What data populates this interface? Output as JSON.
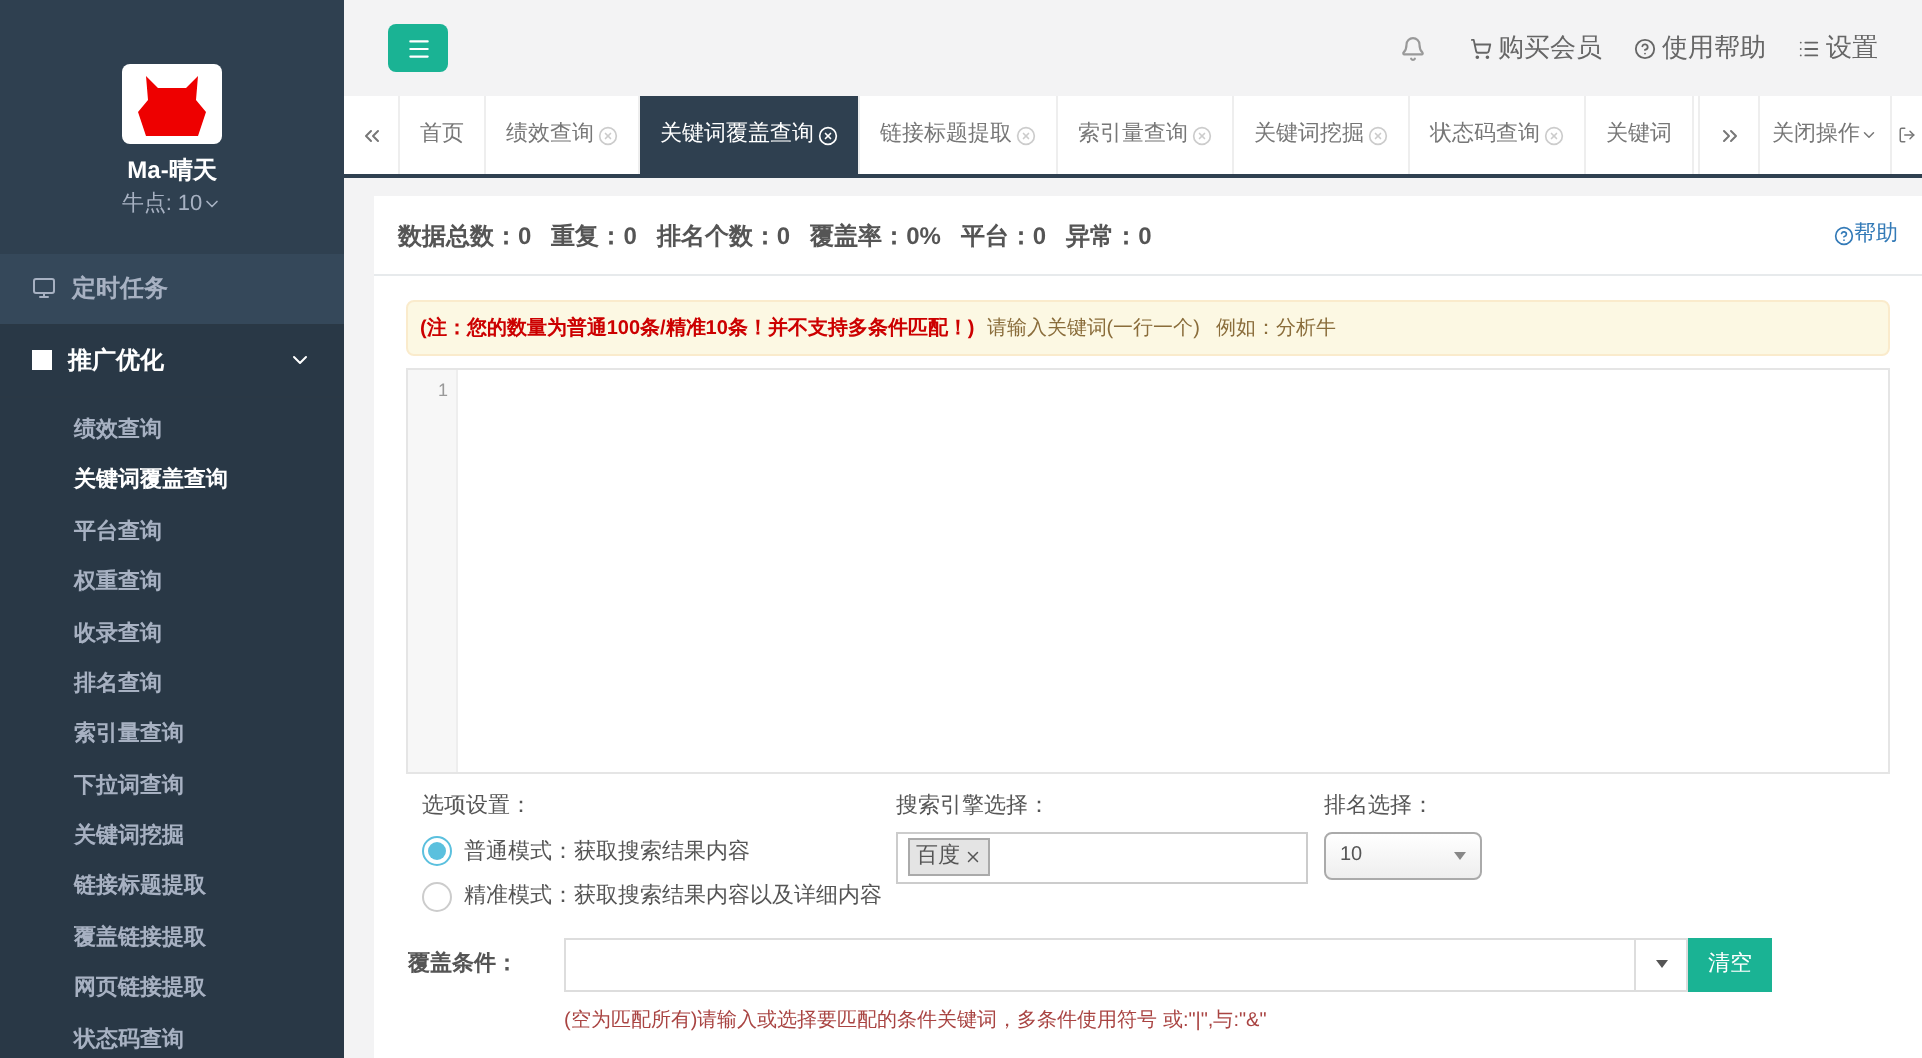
{
  "profile": {
    "name": "Ma-晴天",
    "points": "牛点: 10"
  },
  "sidebar": {
    "items": [
      {
        "label": "定时任务",
        "kind": "single",
        "expanded": false
      },
      {
        "label": "推广优化",
        "kind": "group",
        "expanded": true,
        "children": [
          {
            "label": "绩效查询",
            "selected": false
          },
          {
            "label": "关键词覆盖查询",
            "selected": true
          },
          {
            "label": "平台查询",
            "selected": false
          },
          {
            "label": "权重查询",
            "selected": false
          },
          {
            "label": "收录查询",
            "selected": false
          },
          {
            "label": "排名查询",
            "selected": false
          },
          {
            "label": "索引量查询",
            "selected": false
          },
          {
            "label": "下拉词查询",
            "selected": false
          },
          {
            "label": "关键词挖掘",
            "selected": false
          },
          {
            "label": "链接标题提取",
            "selected": false
          },
          {
            "label": "覆盖链接提取",
            "selected": false
          },
          {
            "label": "网页链接提取",
            "selected": false
          },
          {
            "label": "状态码查询",
            "selected": false
          }
        ]
      }
    ]
  },
  "topbar": {
    "links": [
      "购买会员",
      "使用帮助",
      "设置"
    ]
  },
  "tabs": [
    {
      "label": "首页",
      "closable": false,
      "selected": false
    },
    {
      "label": "绩效查询",
      "closable": true,
      "selected": false
    },
    {
      "label": "关键词覆盖查询",
      "closable": true,
      "selected": true
    },
    {
      "label": "链接标题提取",
      "closable": true,
      "selected": false
    },
    {
      "label": "索引量查询",
      "closable": true,
      "selected": false
    },
    {
      "label": "关键词挖掘",
      "closable": true,
      "selected": false
    },
    {
      "label": "状态码查询",
      "closable": true,
      "selected": false
    },
    {
      "label": "关键词",
      "closable": false,
      "selected": false
    }
  ],
  "tab_actions": {
    "close_menu": "关闭操作"
  },
  "stats": [
    {
      "label": "数据总数：",
      "value": "0"
    },
    {
      "label": "重复：",
      "value": "0"
    },
    {
      "label": "排名个数：",
      "value": "0"
    },
    {
      "label": "覆盖率：",
      "value": "0%"
    },
    {
      "label": "平台：",
      "value": "0"
    },
    {
      "label": "异常：",
      "value": "0"
    }
  ],
  "help_link": "帮助",
  "notice": {
    "warning": "(注：您的数量为普通100条/精准10条！并不支持多条件匹配！)",
    "hint": "请输入关键词(一行一个)   例如：分析牛"
  },
  "editor": {
    "line_numbers": [
      "1"
    ]
  },
  "options": {
    "label": "选项设置：",
    "modes": [
      {
        "label": "普通模式：获取搜索结果内容",
        "selected": true
      },
      {
        "label": "精准模式：获取搜索结果内容以及详细内容",
        "selected": false
      }
    ]
  },
  "engine": {
    "label": "搜索引擎选择：",
    "tags": [
      "百度"
    ]
  },
  "rank": {
    "label": "排名选择：",
    "value": "10"
  },
  "condition": {
    "label": "覆盖条件：",
    "button": "清空",
    "help": "(空为匹配所有)请输入或选择要匹配的条件关键词，多条件使用符号 或:\"|\",与:\"&\""
  }
}
